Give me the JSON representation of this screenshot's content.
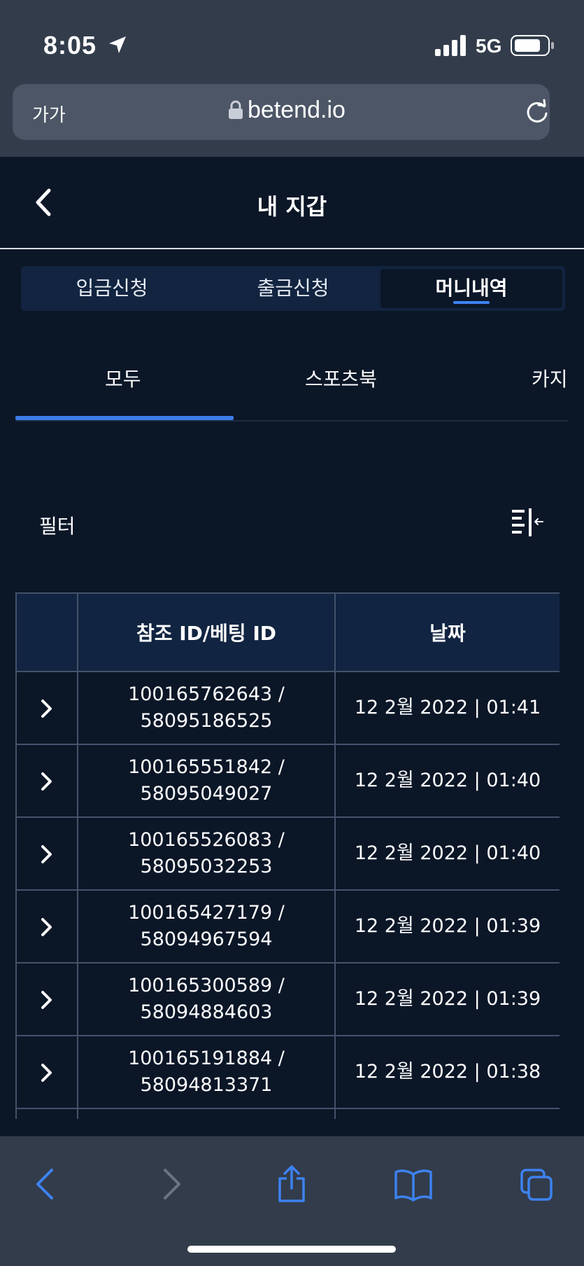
{
  "status_bar": {
    "time": "8:05",
    "network": "5G"
  },
  "browser": {
    "text_size_label": "가가",
    "url": "betend.io"
  },
  "header": {
    "title": "내 지갑"
  },
  "segment_tabs": [
    {
      "label": "입금신청",
      "active": false
    },
    {
      "label": "출금신청",
      "active": false
    },
    {
      "label": "머니내역",
      "active": true
    }
  ],
  "category_tabs": [
    {
      "label": "모두",
      "active": true
    },
    {
      "label": "스포츠북",
      "active": false
    },
    {
      "label": "카지",
      "active": false
    }
  ],
  "filter": {
    "label": "필터"
  },
  "table": {
    "columns": [
      "",
      "참조 ID/베팅 ID",
      "날짜"
    ],
    "rows": [
      {
        "ref_id": "100165762643 /",
        "bet_id": "58095186525",
        "date": "12 2월 2022 | 01:41"
      },
      {
        "ref_id": "100165551842 /",
        "bet_id": "58095049027",
        "date": "12 2월 2022 | 01:40"
      },
      {
        "ref_id": "100165526083 /",
        "bet_id": "58095032253",
        "date": "12 2월 2022 | 01:40"
      },
      {
        "ref_id": "100165427179 /",
        "bet_id": "58094967594",
        "date": "12 2월 2022 | 01:39"
      },
      {
        "ref_id": "100165300589 /",
        "bet_id": "58094884603",
        "date": "12 2월 2022 | 01:39"
      },
      {
        "ref_id": "100165191884 /",
        "bet_id": "58094813371",
        "date": "12 2월 2022 | 01:38"
      }
    ]
  },
  "colors": {
    "background": "#0b1627",
    "browser_chrome": "#323c4b",
    "accent": "#3b7de8",
    "table_header": "#112441",
    "table_border": "#44526a"
  },
  "icons": {
    "status": [
      "location-arrow-icon",
      "cellular-signal-icon",
      "battery-icon"
    ],
    "browser_top": [
      "lock-icon",
      "reload-icon"
    ],
    "header": [
      "chevron-left-icon"
    ],
    "filter": [
      "filter-sort-icon"
    ],
    "row": "chevron-right-icon",
    "toolbar": [
      "back-icon",
      "forward-icon",
      "share-icon",
      "bookmarks-icon",
      "tabs-icon"
    ]
  }
}
